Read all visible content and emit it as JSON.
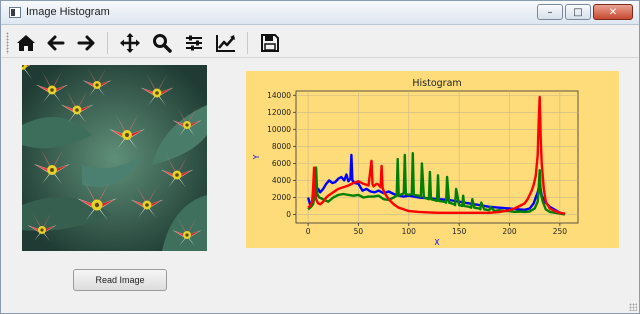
{
  "window": {
    "title": "Image Histogram",
    "minimize_symbol": "–",
    "maximize_symbol": "□",
    "close_symbol": "✕"
  },
  "toolbar": {
    "icons": [
      "home-icon",
      "back-arrow-icon",
      "forward-arrow-icon",
      "pan-icon",
      "zoom-icon",
      "configure-subplots-icon",
      "edit-axis-icon",
      "save-icon"
    ]
  },
  "left_panel": {
    "image_subject": "tulips"
  },
  "buttons": {
    "read_image": "Read Image"
  },
  "chart_data": {
    "type": "line",
    "title": "Histogram",
    "xlabel": "X",
    "ylabel": "Y",
    "xlim": [
      -12,
      268
    ],
    "ylim": [
      -1000,
      14500
    ],
    "x_ticks": [
      0,
      50,
      100,
      150,
      200,
      250
    ],
    "y_ticks": [
      0,
      2000,
      4000,
      6000,
      8000,
      10000,
      12000,
      14000
    ],
    "grid": true,
    "background_color": "#fddc79",
    "axes_color": "#fddc79",
    "label_colors": {
      "xlabel": "#0000ff",
      "ylabel": "#0000ff"
    },
    "series": [
      {
        "color": "#0000ff",
        "x": [
          0,
          2,
          4,
          6,
          8,
          10,
          12,
          15,
          18,
          21,
          24,
          27,
          30,
          33,
          36,
          38,
          40,
          42,
          43,
          44,
          46,
          50,
          54,
          58,
          62,
          66,
          70,
          75,
          80,
          85,
          90,
          95,
          100,
          110,
          120,
          130,
          140,
          150,
          160,
          170,
          180,
          190,
          200,
          210,
          215,
          220,
          224,
          226,
          228,
          230,
          232,
          235,
          240,
          250,
          255
        ],
        "y": [
          2000,
          1200,
          1400,
          1800,
          2200,
          3000,
          2600,
          3000,
          3600,
          4000,
          3700,
          3800,
          4200,
          4400,
          4000,
          4700,
          3900,
          4200,
          7000,
          4000,
          3700,
          3600,
          2800,
          3000,
          2700,
          2600,
          2800,
          2500,
          2700,
          2400,
          2200,
          2100,
          2200,
          2000,
          1900,
          1800,
          1700,
          1500,
          1300,
          1100,
          900,
          800,
          700,
          600,
          550,
          700,
          1300,
          2000,
          2600,
          3600,
          2200,
          1500,
          900,
          200,
          0
        ]
      },
      {
        "color": "#008000",
        "x": [
          0,
          3,
          5,
          7,
          8,
          9,
          11,
          13,
          16,
          20,
          25,
          30,
          35,
          40,
          45,
          50,
          55,
          60,
          65,
          70,
          75,
          80,
          85,
          88,
          89,
          90,
          95,
          96,
          97,
          100,
          103,
          104,
          105,
          110,
          112,
          113,
          115,
          120,
          121,
          122,
          125,
          128,
          129,
          130,
          135,
          137,
          138,
          140,
          145,
          146,
          147,
          150,
          153,
          154,
          155,
          160,
          162,
          163,
          165,
          170,
          171,
          172,
          175,
          180,
          181,
          185,
          190,
          195,
          200,
          205,
          210,
          215,
          220,
          225,
          228,
          229,
          230,
          231,
          233,
          236,
          240,
          250,
          255
        ],
        "y": [
          600,
          900,
          1200,
          2500,
          5500,
          2400,
          2000,
          1900,
          1700,
          1500,
          2000,
          2300,
          2400,
          2300,
          2200,
          2300,
          2000,
          2100,
          2100,
          2200,
          1800,
          1700,
          2000,
          2200,
          6500,
          2200,
          2500,
          7000,
          2400,
          2300,
          2400,
          7200,
          2300,
          2200,
          2100,
          6000,
          2000,
          1800,
          5000,
          1800,
          1700,
          1600,
          4600,
          1600,
          1500,
          1400,
          4400,
          1400,
          1200,
          1100,
          3000,
          1100,
          1000,
          2200,
          1000,
          900,
          800,
          1800,
          800,
          700,
          600,
          1400,
          600,
          500,
          900,
          400,
          500,
          400,
          400,
          300,
          350,
          300,
          350,
          700,
          1500,
          3200,
          5200,
          2500,
          1500,
          600,
          300,
          100,
          0
        ]
      },
      {
        "color": "#ff0000",
        "x": [
          0,
          2,
          4,
          5,
          6,
          7,
          8,
          9,
          10,
          12,
          15,
          18,
          20,
          25,
          30,
          35,
          40,
          45,
          50,
          55,
          60,
          63,
          64,
          65,
          68,
          70,
          72,
          73,
          74,
          76,
          80,
          85,
          90,
          95,
          100,
          110,
          120,
          130,
          140,
          150,
          160,
          170,
          180,
          190,
          200,
          205,
          210,
          215,
          218,
          220,
          222,
          224,
          226,
          228,
          229,
          230,
          231,
          232,
          234,
          236,
          240,
          245,
          250,
          255
        ],
        "y": [
          800,
          1000,
          1500,
          3000,
          5500,
          2400,
          1800,
          1500,
          1300,
          1200,
          1500,
          2000,
          2200,
          2600,
          3000,
          3200,
          3400,
          3700,
          3900,
          3600,
          3400,
          6300,
          3600,
          3300,
          3600,
          3500,
          3200,
          5700,
          3100,
          2500,
          1800,
          1200,
          800,
          600,
          400,
          300,
          250,
          200,
          200,
          200,
          200,
          200,
          200,
          300,
          500,
          700,
          1000,
          1300,
          1800,
          2300,
          2800,
          3500,
          4500,
          7000,
          11000,
          13800,
          9000,
          6000,
          3000,
          1500,
          700,
          400,
          200,
          100
        ]
      }
    ]
  }
}
